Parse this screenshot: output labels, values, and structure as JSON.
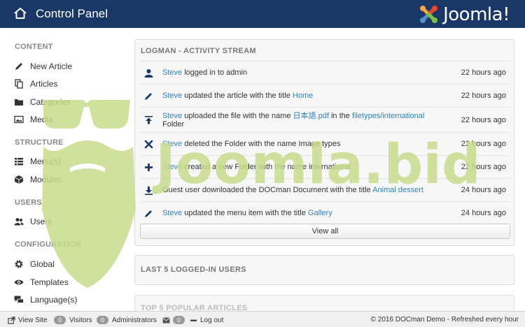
{
  "header": {
    "title": "Control Panel",
    "brand": "Joomla!",
    "home_icon": "home-icon"
  },
  "sidebar": {
    "sections": [
      {
        "label": "CONTENT",
        "items": [
          {
            "label": "New Article",
            "icon": "pencil-icon"
          },
          {
            "label": "Articles",
            "icon": "copy-icon"
          },
          {
            "label": "Categories",
            "icon": "folder-icon"
          },
          {
            "label": "Media",
            "icon": "image-icon"
          }
        ]
      },
      {
        "label": "STRUCTURE",
        "items": [
          {
            "label": "Menu(s)",
            "icon": "list-icon"
          },
          {
            "label": "Modules",
            "icon": "cube-icon"
          }
        ]
      },
      {
        "label": "USERS",
        "items": [
          {
            "label": "Users",
            "icon": "users-icon"
          }
        ]
      },
      {
        "label": "CONFIGURATION",
        "items": [
          {
            "label": "Global",
            "icon": "cog-icon"
          },
          {
            "label": "Templates",
            "icon": "eye-icon"
          },
          {
            "label": "Language(s)",
            "icon": "comments-icon"
          }
        ]
      }
    ]
  },
  "activity": {
    "title": "LOGMAN - ACTIVITY STREAM",
    "rows": [
      {
        "icon": "user-icon",
        "actor": "Steve",
        "text": "logged in to admin",
        "link": "",
        "text2": "",
        "link2": "",
        "text3": "",
        "time": "22 hours ago"
      },
      {
        "icon": "pencil-icon",
        "actor": "Steve",
        "text": "updated the article with the title",
        "link": "Home",
        "text2": "",
        "link2": "",
        "text3": "",
        "time": "22 hours ago"
      },
      {
        "icon": "upload-icon",
        "actor": "Steve",
        "text": "uploaded the file with the name",
        "link": "日本語.pdf",
        "text2": "in the",
        "link2": "filetypes/international",
        "text3": "Folder",
        "time": "22 hours ago"
      },
      {
        "icon": "delete-icon",
        "actor": "Steve",
        "text": "deleted the Folder with the name Image types",
        "link": "",
        "text2": "",
        "link2": "",
        "text3": "",
        "time": "22 hours ago"
      },
      {
        "icon": "plus-icon",
        "actor": "Steve",
        "text": "created a new Folder with the name international",
        "link": "",
        "text2": "",
        "link2": "",
        "text3": "",
        "time": "22 hours ago"
      },
      {
        "icon": "download-icon",
        "actor": "",
        "text": "Guest user downloaded the DOCman Document with the title",
        "link": "Animal dessert",
        "text2": "",
        "link2": "",
        "text3": "",
        "time": "24 hours ago"
      },
      {
        "icon": "pencil-icon",
        "actor": "Steve",
        "text": "updated the menu item with the title",
        "link": "Gallery",
        "text2": "",
        "link2": "",
        "text3": "",
        "time": "24 hours ago"
      }
    ],
    "view_all": "View all"
  },
  "logged_in": {
    "title": "LAST 5 LOGGED-IN USERS"
  },
  "popular": {
    "title": "TOP 5 POPULAR ARTICLES"
  },
  "footer": {
    "view_site": "View Site",
    "visitors_count": "0",
    "visitors_label": "Visitors",
    "admins_count": "0",
    "admins_label": "Administrators",
    "messages_count": "0",
    "logout": "Log out",
    "copyright": "© 2016 DOCman Demo - Refreshed every hour"
  },
  "watermark": {
    "text": "Joomla.bid",
    "color": "#c8dc8c"
  },
  "colors": {
    "header_bg": "#1a3867",
    "link": "#2d82c0",
    "panel_bg": "#f7f7f7"
  }
}
